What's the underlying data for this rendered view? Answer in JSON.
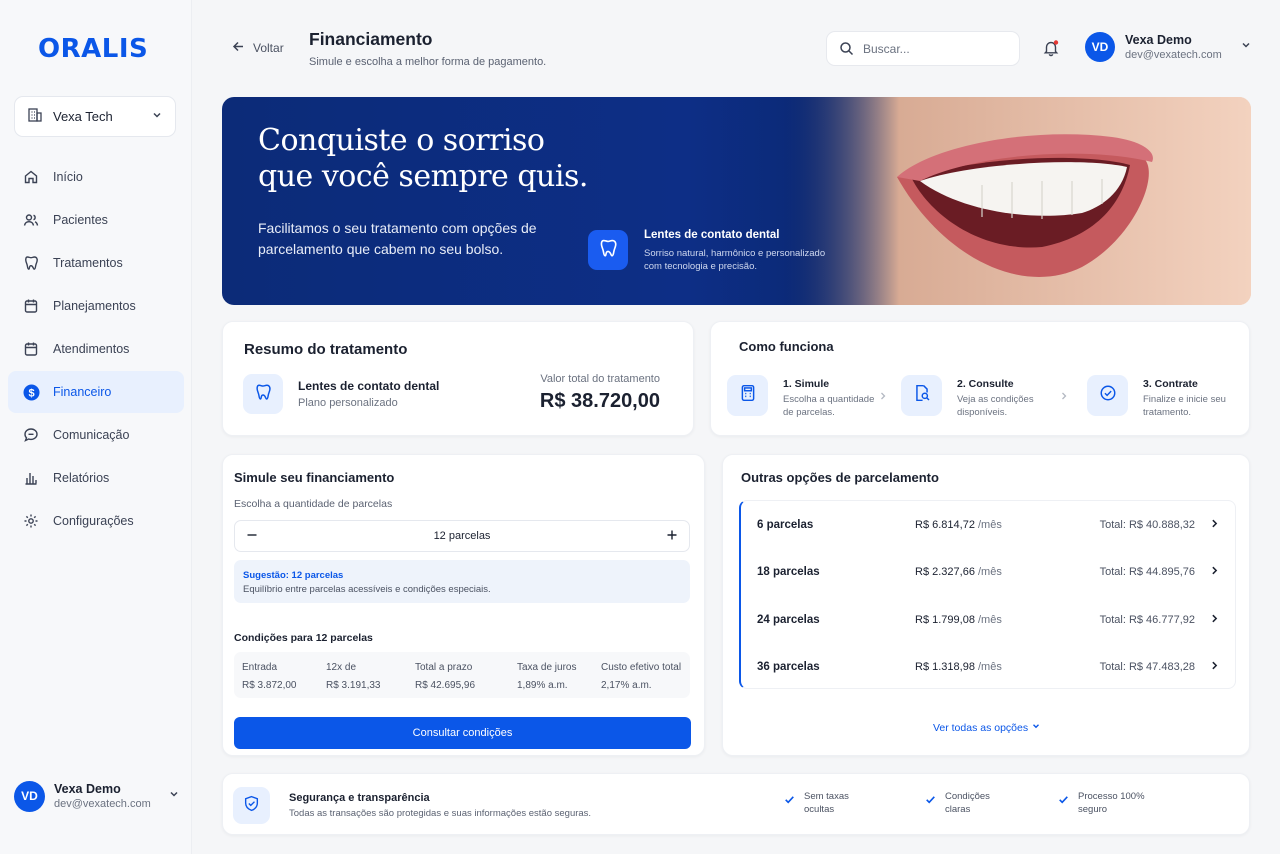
{
  "brand": "ORALIS",
  "org": "Vexa Tech",
  "nav": [
    {
      "label": "Início",
      "icon": "home-icon"
    },
    {
      "label": "Pacientes",
      "icon": "users-icon"
    },
    {
      "label": "Tratamentos",
      "icon": "tooth-icon"
    },
    {
      "label": "Planejamentos",
      "icon": "calendar-icon"
    },
    {
      "label": "Atendimentos",
      "icon": "calendar-icon"
    },
    {
      "label": "Financeiro",
      "icon": "dollar-icon",
      "active": true
    },
    {
      "label": "Comunicação",
      "icon": "chat-icon"
    },
    {
      "label": "Relatórios",
      "icon": "chart-icon"
    },
    {
      "label": "Configurações",
      "icon": "gear-icon"
    }
  ],
  "user": {
    "initials": "VD",
    "name": "Vexa Demo",
    "email": "dev@vexatech.com"
  },
  "header": {
    "back": "Voltar",
    "title": "Financiamento",
    "subtitle": "Simule e escolha a melhor forma de pagamento.",
    "search_placeholder": "Buscar..."
  },
  "hero": {
    "title": "Conquiste o sorriso que você sempre quis.",
    "text": "Facilitamos o seu tratamento com opções de parcelamento que cabem no seu bolso.",
    "feature_title": "Lentes de contato dental",
    "feature_text": "Sorriso natural, harmônico e personalizado com tecnologia e precisão."
  },
  "resumo": {
    "title": "Resumo do tratamento",
    "name": "Lentes de contato dental",
    "sub": "Plano personalizado",
    "value_label": "Valor total do tratamento",
    "value": "R$ 38.720,00"
  },
  "como": {
    "title": "Como funciona",
    "steps": [
      {
        "title": "1. Simule",
        "desc": "Escolha a quantidade de parcelas."
      },
      {
        "title": "2. Consulte",
        "desc": "Veja as condições disponíveis."
      },
      {
        "title": "3. Contrate",
        "desc": "Finalize e inicie seu tratamento."
      }
    ]
  },
  "simule": {
    "title": "Simule seu financiamento",
    "label": "Escolha a quantidade de parcelas",
    "value": "12 parcelas",
    "suggestion_title": "Sugestão: 12 parcelas",
    "suggestion_text": "Equilíbrio entre parcelas acessíveis e condições especiais.",
    "cond_title": "Condições para 12 parcelas",
    "conditions": [
      {
        "label": "Entrada",
        "value": "R$ 3.872,00"
      },
      {
        "label": "12x de",
        "value": "R$ 3.191,33"
      },
      {
        "label": "Total a prazo",
        "value": "R$ 42.695,96"
      },
      {
        "label": "Taxa de juros",
        "value": "1,89% a.m."
      },
      {
        "label": "Custo efetivo total",
        "value": "2,17% a.m."
      }
    ],
    "button": "Consultar condições"
  },
  "outras": {
    "title": "Outras opções de parcelamento",
    "rows": [
      {
        "n": "6 parcelas",
        "m": "R$ 6.814,72",
        "per": "/mês",
        "total": "Total: R$ 40.888,32"
      },
      {
        "n": "18 parcelas",
        "m": "R$ 2.327,66",
        "per": "/mês",
        "total": "Total: R$ 44.895,76"
      },
      {
        "n": "24 parcelas",
        "m": "R$ 1.799,08",
        "per": "/mês",
        "total": "Total: R$ 46.777,92"
      },
      {
        "n": "36 parcelas",
        "m": "R$ 1.318,98",
        "per": "/mês",
        "total": "Total: R$ 47.483,28"
      }
    ],
    "link": "Ver todas as opções"
  },
  "seguranca": {
    "title": "Segurança e transparência",
    "text": "Todas as transações são protegidas e suas informações estão seguras.",
    "features": [
      "Sem taxas ocultas",
      "Condições claras",
      "Processo 100% seguro"
    ]
  },
  "colors": {
    "accent": "#0b57e8",
    "hero_bg": "#0c2b78"
  }
}
